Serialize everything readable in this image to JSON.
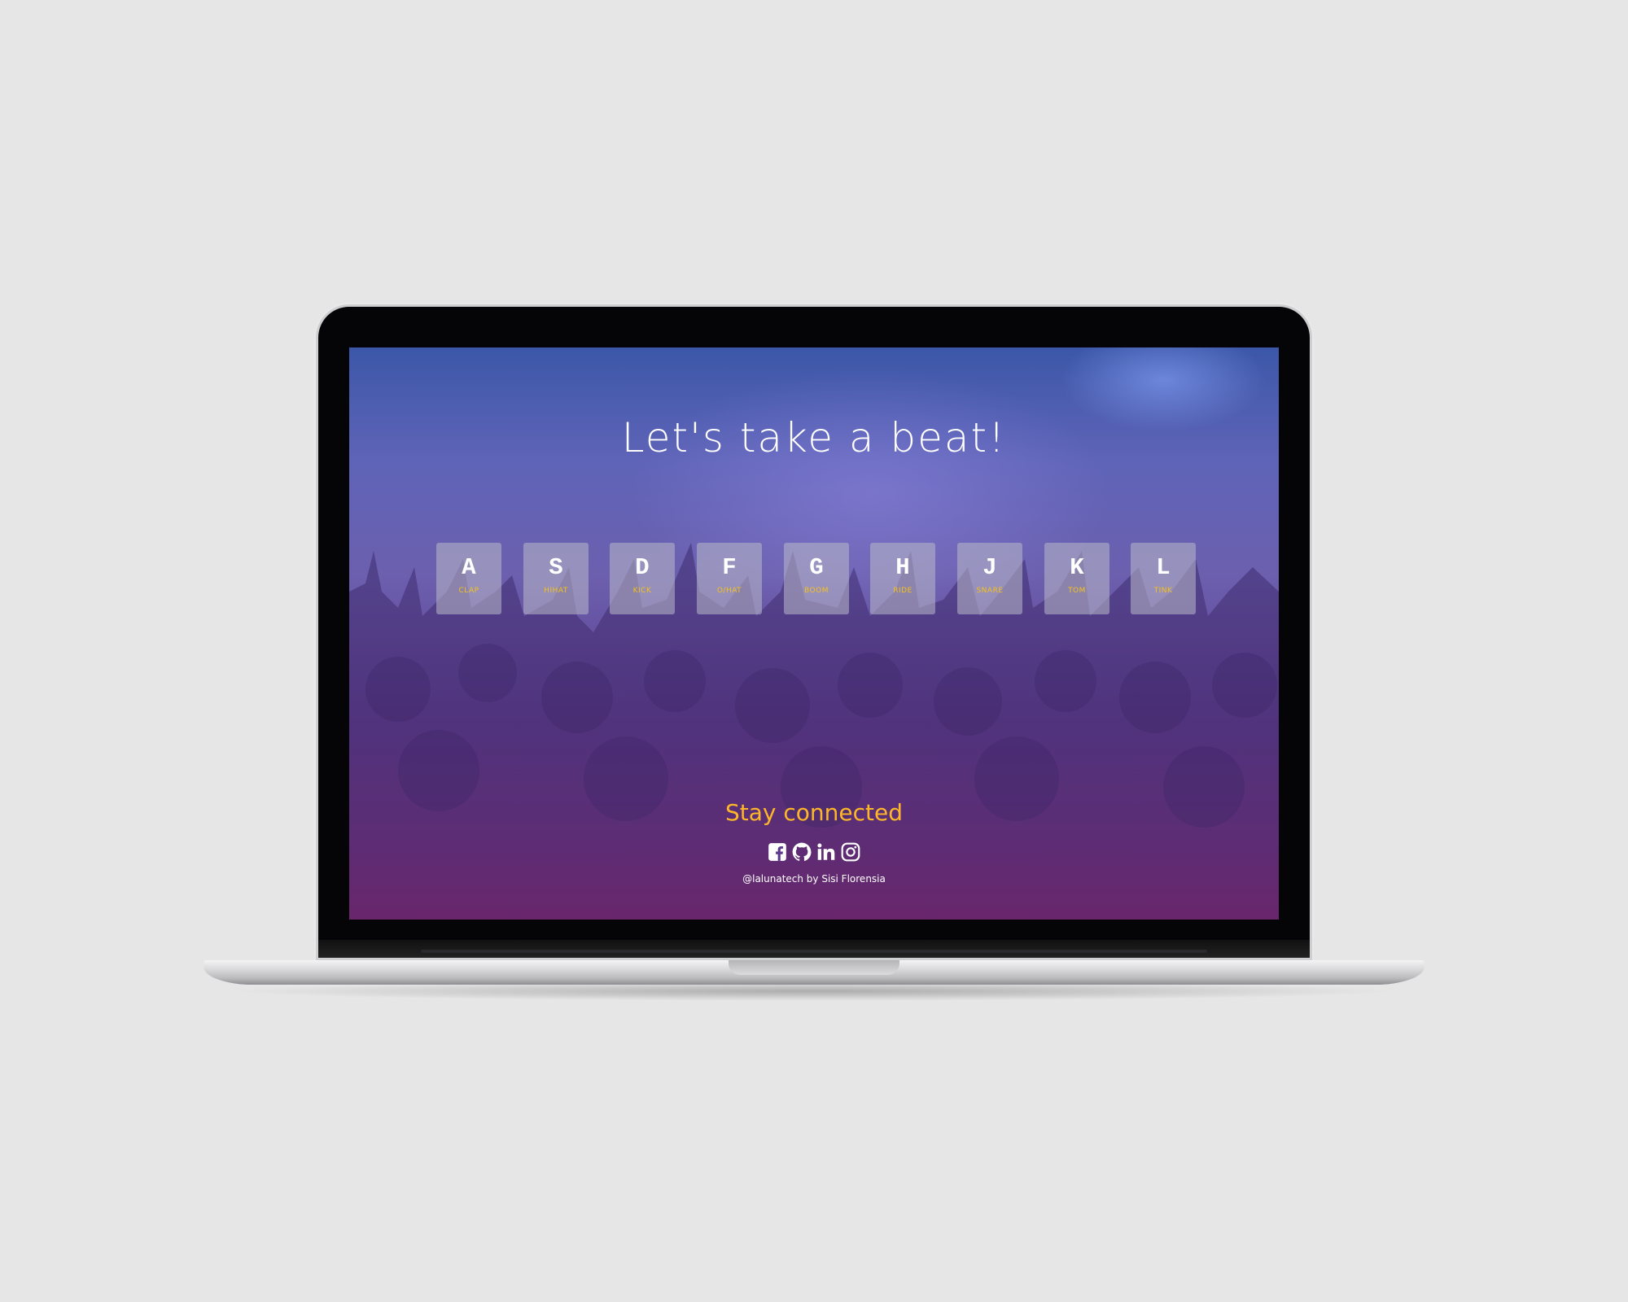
{
  "page": {
    "title": "Let's take a beat!"
  },
  "keys": [
    {
      "letter": "A",
      "sound": "CLAP"
    },
    {
      "letter": "S",
      "sound": "HIHAT"
    },
    {
      "letter": "D",
      "sound": "KICK"
    },
    {
      "letter": "F",
      "sound": "O/HAT"
    },
    {
      "letter": "G",
      "sound": "BOOM"
    },
    {
      "letter": "H",
      "sound": "RIDE"
    },
    {
      "letter": "J",
      "sound": "SNARE"
    },
    {
      "letter": "K",
      "sound": "TOM"
    },
    {
      "letter": "L",
      "sound": "TINK"
    }
  ],
  "footer": {
    "heading": "Stay connected",
    "social_icons": [
      "facebook-icon",
      "github-icon",
      "linkedin-icon",
      "instagram-icon"
    ],
    "credit": "@lalunatech by Sisi Florensia"
  },
  "colors": {
    "accent": "#fdb628",
    "key_sound": "#f5c218",
    "desktop_background": "#e6e6e6"
  }
}
